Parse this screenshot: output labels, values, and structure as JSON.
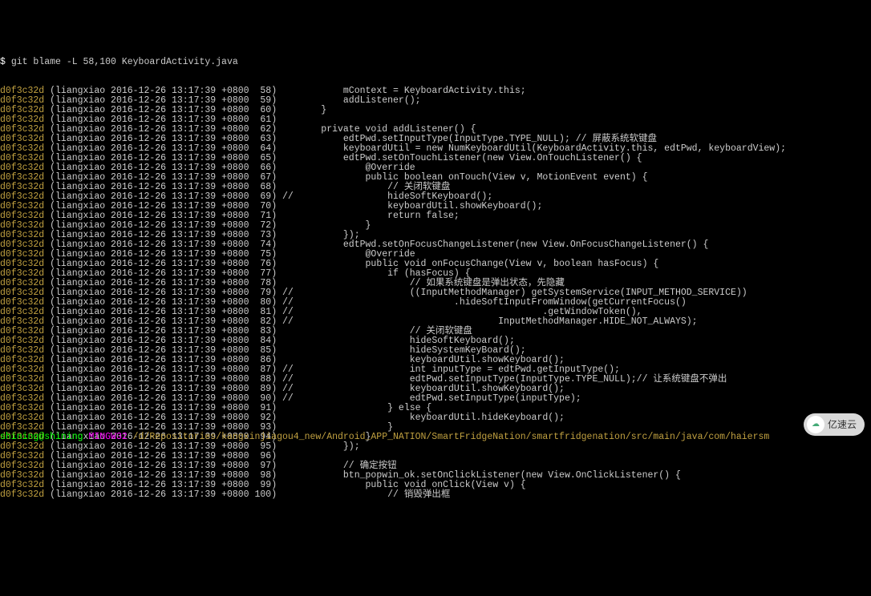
{
  "command_line": {
    "prompt": "$",
    "command": "git blame -L 58,100 KeyboardActivity.java"
  },
  "blame": {
    "hash": "d0f3c32d",
    "author": "(liangxiao",
    "date": "2016-12-26 13:17:39 +0800",
    "rows": [
      {
        "n": " 58)",
        "code": "            mContext = KeyboardActivity.this;"
      },
      {
        "n": " 59)",
        "code": "            addListener();"
      },
      {
        "n": " 60)",
        "code": "        }"
      },
      {
        "n": " 61)",
        "code": ""
      },
      {
        "n": " 62)",
        "code": "        private void addListener() {"
      },
      {
        "n": " 63)",
        "code": "            edtPwd.setInputType(InputType.TYPE_NULL); // 屏蔽系统软键盘"
      },
      {
        "n": " 64)",
        "code": "            keyboardUtil = new NumKeyboardUtil(KeyboardActivity.this, edtPwd, keyboardView);"
      },
      {
        "n": " 65)",
        "code": "            edtPwd.setOnTouchListener(new View.OnTouchListener() {"
      },
      {
        "n": " 66)",
        "code": "                @Override"
      },
      {
        "n": " 67)",
        "code": "                public boolean onTouch(View v, MotionEvent event) {"
      },
      {
        "n": " 68)",
        "code": "                    // 关闭软键盘"
      },
      {
        "n": " 69)",
        "code": " //                 hideSoftKeyboard();"
      },
      {
        "n": " 70)",
        "code": "                    keyboardUtil.showKeyboard();"
      },
      {
        "n": " 71)",
        "code": "                    return false;"
      },
      {
        "n": " 72)",
        "code": "                }"
      },
      {
        "n": " 73)",
        "code": "            });"
      },
      {
        "n": " 74)",
        "code": "            edtPwd.setOnFocusChangeListener(new View.OnFocusChangeListener() {"
      },
      {
        "n": " 75)",
        "code": "                @Override"
      },
      {
        "n": " 76)",
        "code": "                public void onFocusChange(View v, boolean hasFocus) {"
      },
      {
        "n": " 77)",
        "code": "                    if (hasFocus) {"
      },
      {
        "n": " 78)",
        "code": "                        // 如果系统键盘是弹出状态，先隐藏"
      },
      {
        "n": " 79)",
        "code": " //                     ((InputMethodManager) getSystemService(INPUT_METHOD_SERVICE))"
      },
      {
        "n": " 80)",
        "code": " //                             .hideSoftInputFromWindow(getCurrentFocus()"
      },
      {
        "n": " 81)",
        "code": " //                                             .getWindowToken(),"
      },
      {
        "n": " 82)",
        "code": " //                                     InputMethodManager.HIDE_NOT_ALWAYS);"
      },
      {
        "n": " 83)",
        "code": "                        // 关闭软键盘"
      },
      {
        "n": " 84)",
        "code": "                        hideSoftKeyboard();"
      },
      {
        "n": " 85)",
        "code": "                        hideSystemKeyBoard();"
      },
      {
        "n": " 86)",
        "code": "                        keyboardUtil.showKeyboard();"
      },
      {
        "n": " 87)",
        "code": " //                     int inputType = edtPwd.getInputType();"
      },
      {
        "n": " 88)",
        "code": " //                     edtPwd.setInputType(InputType.TYPE_NULL);// 让系统键盘不弹出"
      },
      {
        "n": " 89)",
        "code": " //                     keyboardUtil.showKeyboard();"
      },
      {
        "n": " 90)",
        "code": " //                     edtPwd.setInputType(inputType);"
      },
      {
        "n": " 91)",
        "code": "                    } else {"
      },
      {
        "n": " 92)",
        "code": "                        keyboardUtil.hideKeyboard();"
      },
      {
        "n": " 93)",
        "code": "                    }"
      },
      {
        "n": " 94)",
        "code": "                }"
      },
      {
        "n": " 95)",
        "code": "            });"
      },
      {
        "n": " 96)",
        "code": ""
      },
      {
        "n": " 97)",
        "code": "            // 确定按钮"
      },
      {
        "n": " 98)",
        "code": "            btn_popwin_ok.setOnClickListener(new View.OnClickListener() {"
      },
      {
        "n": " 99)",
        "code": "                public void onClick(View v) {"
      },
      {
        "n": "100)",
        "code": "                    // 销毁弹出框"
      }
    ]
  },
  "shell_prompt": {
    "user": "shining",
    "at": "@",
    "host": "shining",
    "sep": " ",
    "mingw": "MINGW32",
    "path": " /d/Repositories/kangxinjiagou4_new/Android_APP_NATION/SmartFridgeNation/smartfridgenation/src/main/java/com/haiersm"
  },
  "watermark": {
    "text": "亿速云"
  }
}
